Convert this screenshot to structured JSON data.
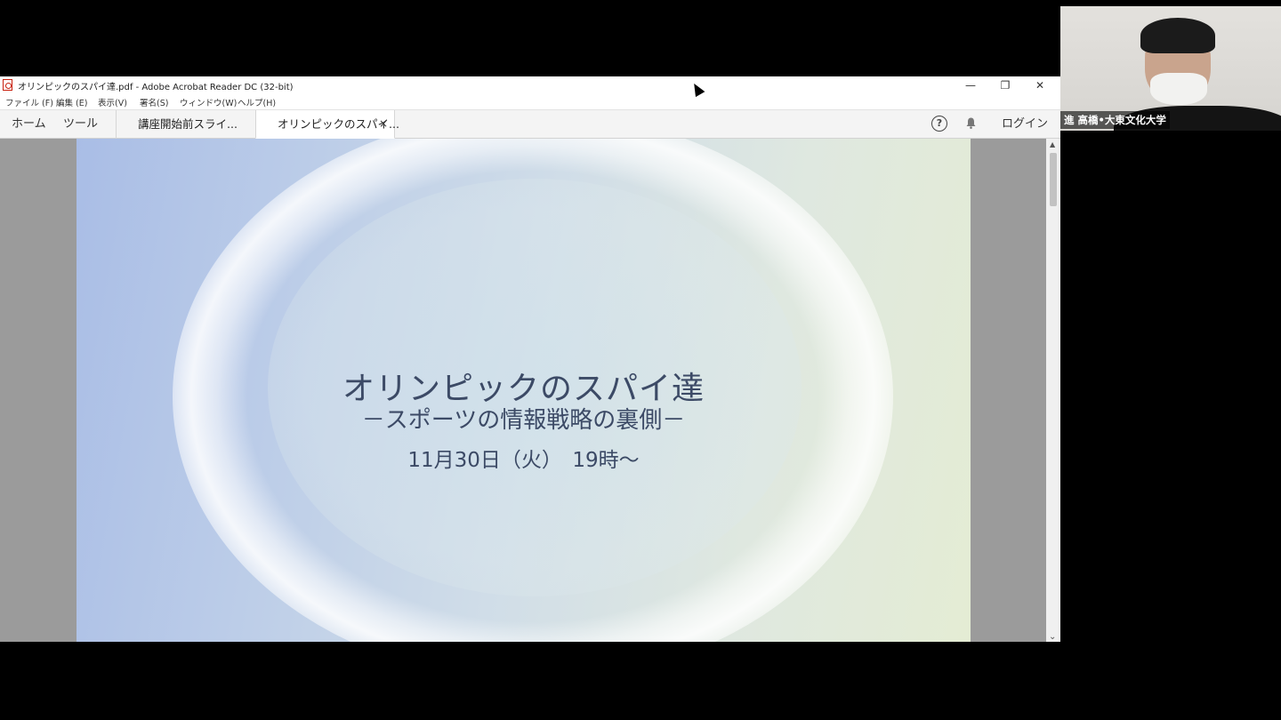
{
  "window": {
    "title": "オリンピックのスパイ達.pdf - Adobe Acrobat Reader DC (32-bit)",
    "controls": {
      "minimize": "—",
      "restore": "❐",
      "close": "✕"
    }
  },
  "menu": {
    "items": [
      "ファイル (F)",
      "編集 (E)",
      "表示(V)",
      "署名(S)",
      "ウィンドウ(W)",
      "ヘルプ(H)"
    ]
  },
  "toolbar": {
    "home": "ホーム",
    "tools": "ツール",
    "tabs": [
      {
        "label": "講座開始前スライ..."
      },
      {
        "label": "オリンピックのスパイ...",
        "close": "×"
      }
    ],
    "help_glyph": "?",
    "login": "ログイン"
  },
  "slide": {
    "title": "オリンピックのスパイ達",
    "subtitle": "－スポーツの情報戦略の裏側－",
    "date": "11月30日（火）　19時～"
  },
  "scrollbar": {
    "up": "▲",
    "down": "⌄"
  },
  "webcam": {
    "name_label": "進 高橋•大東文化大学"
  }
}
